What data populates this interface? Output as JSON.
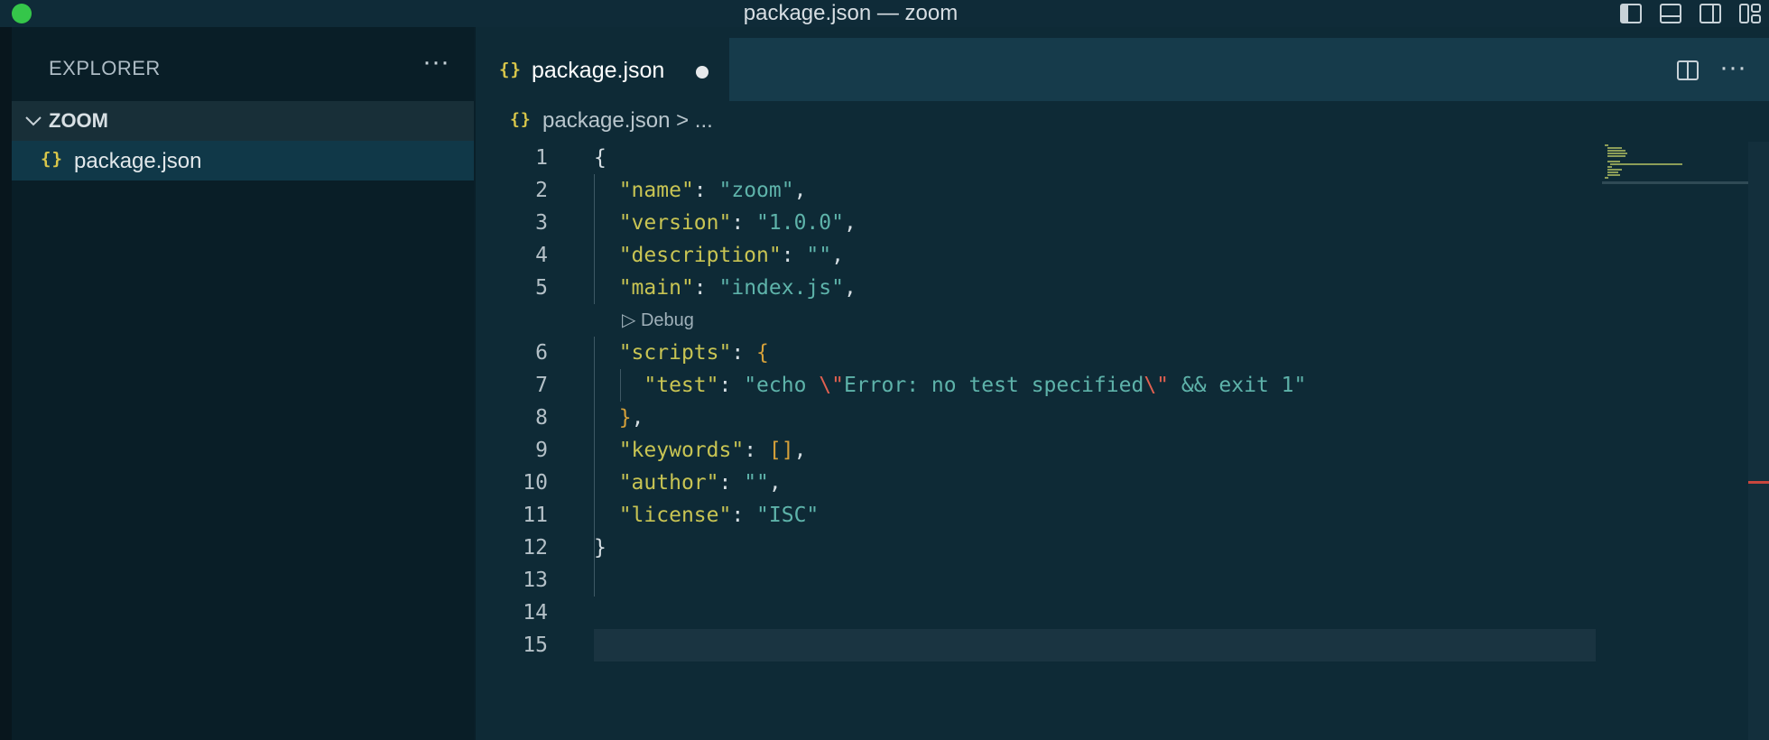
{
  "window": {
    "title": "package.json — zoom"
  },
  "sidebar": {
    "title": "EXPLORER",
    "more_label": "···",
    "section": "ZOOM",
    "files": [
      {
        "name": "package.json",
        "icon": "{}"
      }
    ]
  },
  "editor": {
    "tab": {
      "label": "package.json",
      "icon": "{}",
      "modified": true
    },
    "more_label": "···",
    "breadcrumb": {
      "file": "package.json",
      "rest": " > ..."
    },
    "codelens": "Debug",
    "lines": [
      {
        "n": "1",
        "parts": [
          {
            "t": "{",
            "c": "p"
          }
        ]
      },
      {
        "n": "2",
        "parts": [
          {
            "t": "  ",
            "c": "p"
          },
          {
            "t": "\"name\"",
            "c": "k"
          },
          {
            "t": ": ",
            "c": "p"
          },
          {
            "t": "\"zoom\"",
            "c": "s"
          },
          {
            "t": ",",
            "c": "p"
          }
        ]
      },
      {
        "n": "3",
        "parts": [
          {
            "t": "  ",
            "c": "p"
          },
          {
            "t": "\"version\"",
            "c": "k"
          },
          {
            "t": ": ",
            "c": "p"
          },
          {
            "t": "\"1.0.0\"",
            "c": "s"
          },
          {
            "t": ",",
            "c": "p"
          }
        ]
      },
      {
        "n": "4",
        "parts": [
          {
            "t": "  ",
            "c": "p"
          },
          {
            "t": "\"description\"",
            "c": "k"
          },
          {
            "t": ": ",
            "c": "p"
          },
          {
            "t": "\"\"",
            "c": "s"
          },
          {
            "t": ",",
            "c": "p"
          }
        ]
      },
      {
        "n": "5",
        "parts": [
          {
            "t": "  ",
            "c": "p"
          },
          {
            "t": "\"main\"",
            "c": "k"
          },
          {
            "t": ": ",
            "c": "p"
          },
          {
            "t": "\"index.js\"",
            "c": "s"
          },
          {
            "t": ",",
            "c": "p"
          }
        ]
      },
      {
        "n": "6",
        "parts": [
          {
            "t": "  ",
            "c": "p"
          },
          {
            "t": "\"scripts\"",
            "c": "k"
          },
          {
            "t": ": ",
            "c": "p"
          },
          {
            "t": "{",
            "c": "b"
          }
        ]
      },
      {
        "n": "7",
        "parts": [
          {
            "t": "    ",
            "c": "p"
          },
          {
            "t": "\"test\"",
            "c": "k"
          },
          {
            "t": ": ",
            "c": "p"
          },
          {
            "t": "\"echo ",
            "c": "s"
          },
          {
            "t": "\\\"",
            "c": "e"
          },
          {
            "t": "Error: no test specified",
            "c": "s"
          },
          {
            "t": "\\\"",
            "c": "e"
          },
          {
            "t": " && exit 1\"",
            "c": "s"
          }
        ]
      },
      {
        "n": "8",
        "parts": [
          {
            "t": "  ",
            "c": "p"
          },
          {
            "t": "}",
            "c": "b"
          },
          {
            "t": ",",
            "c": "p"
          }
        ]
      },
      {
        "n": "9",
        "parts": [
          {
            "t": "  ",
            "c": "p"
          },
          {
            "t": "\"keywords\"",
            "c": "k"
          },
          {
            "t": ": ",
            "c": "p"
          },
          {
            "t": "[]",
            "c": "b"
          },
          {
            "t": ",",
            "c": "p"
          }
        ]
      },
      {
        "n": "10",
        "parts": [
          {
            "t": "  ",
            "c": "p"
          },
          {
            "t": "\"author\"",
            "c": "k"
          },
          {
            "t": ": ",
            "c": "p"
          },
          {
            "t": "\"\"",
            "c": "s"
          },
          {
            "t": ",",
            "c": "p"
          }
        ]
      },
      {
        "n": "11",
        "parts": [
          {
            "t": "  ",
            "c": "p"
          },
          {
            "t": "\"license\"",
            "c": "k"
          },
          {
            "t": ": ",
            "c": "p"
          },
          {
            "t": "\"ISC\"",
            "c": "s"
          }
        ]
      },
      {
        "n": "12",
        "parts": [
          {
            "t": "}",
            "c": "p"
          }
        ]
      },
      {
        "n": "13",
        "parts": []
      },
      {
        "n": "14",
        "parts": []
      },
      {
        "n": "15",
        "parts": []
      }
    ]
  },
  "colors": {
    "background": "#0e2a36",
    "sidebar": "#091e27",
    "json_key": "#c8c453",
    "json_string": "#5eb3aa",
    "escape": "#e06050",
    "bracket": "#d6a13a",
    "traffic_light": "#35c64a"
  }
}
